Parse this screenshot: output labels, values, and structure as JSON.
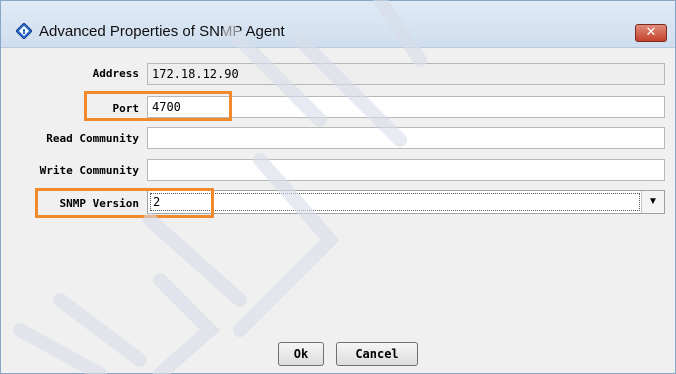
{
  "window": {
    "title": "Advanced Properties of SNMP Agent",
    "close_glyph": "✕"
  },
  "form": {
    "address": {
      "label": "Address",
      "value": "172.18.12.90"
    },
    "port": {
      "label": "Port",
      "value": "4700"
    },
    "read_community": {
      "label": "Read Community",
      "value": ""
    },
    "write_community": {
      "label": "Write Community",
      "value": ""
    },
    "snmp_version": {
      "label": "SNMP Version",
      "value": "2"
    }
  },
  "buttons": {
    "ok": "Ok",
    "cancel": "Cancel"
  },
  "icons": {
    "app": "diamond-info-icon",
    "dropdown": "chevron-down-icon"
  },
  "colors": {
    "highlight": "#f08a2c",
    "watermark": "#d6dbe6"
  }
}
